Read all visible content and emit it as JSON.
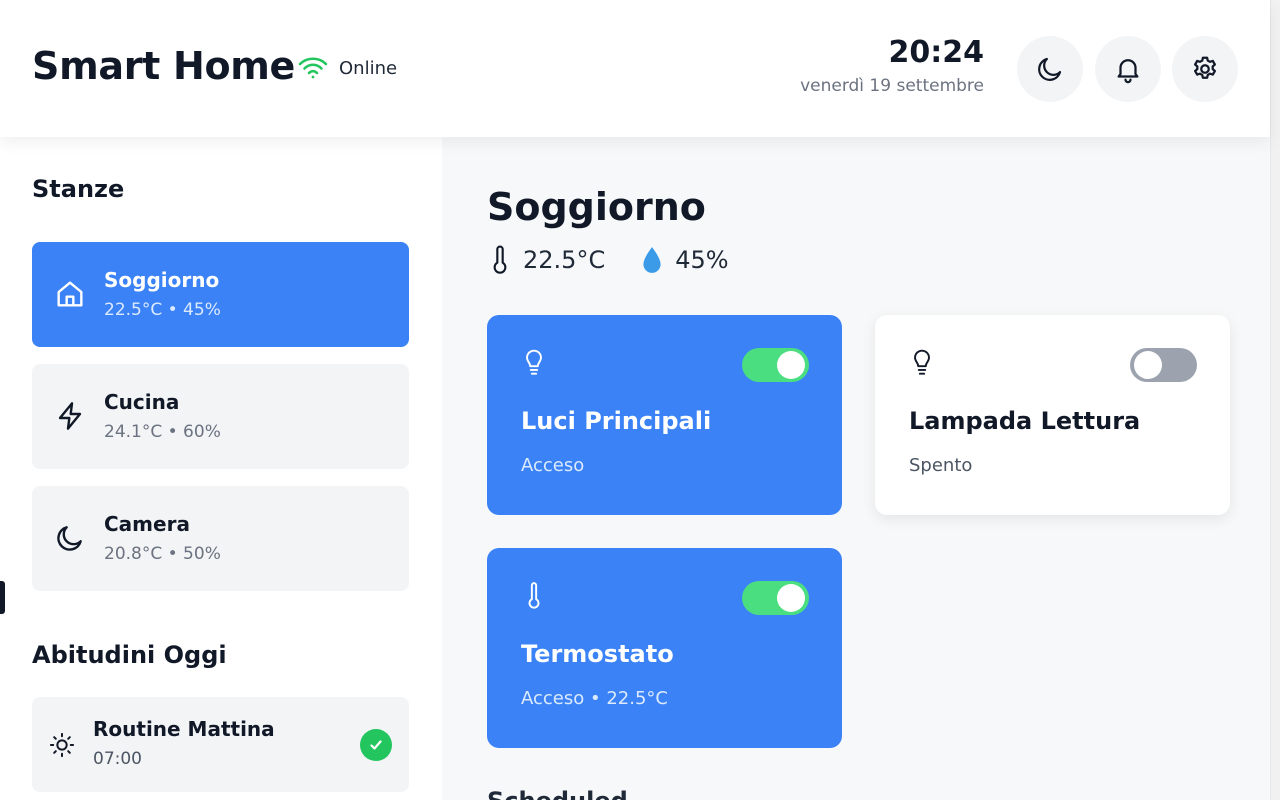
{
  "header": {
    "title": "Smart Home",
    "status": {
      "label": "Online",
      "icon": "wifi-icon",
      "color": "#22c55e"
    },
    "clock": {
      "time": "20:24",
      "date": "venerdì 19 settembre"
    },
    "buttons": [
      {
        "icon": "moon-icon"
      },
      {
        "icon": "bell-icon"
      },
      {
        "icon": "gear-icon"
      }
    ]
  },
  "sidebar": {
    "rooms_title": "Stanze",
    "rooms": [
      {
        "name": "Soggiorno",
        "meta": "22.5°C • 45%",
        "icon": "home-icon",
        "active": true
      },
      {
        "name": "Cucina",
        "meta": "24.1°C • 60%",
        "icon": "bolt-icon",
        "active": false
      },
      {
        "name": "Camera",
        "meta": "20.8°C • 50%",
        "icon": "moon-icon",
        "active": false
      }
    ],
    "habits_title": "Abitudini Oggi",
    "habits": [
      {
        "name": "Routine Mattina",
        "time": "07:00",
        "icon": "sun-icon",
        "done": true
      }
    ]
  },
  "main": {
    "room_title": "Soggiorno",
    "temperature": "22.5°C",
    "humidity": "45%",
    "devices": [
      {
        "name": "Luci Principali",
        "status": "Acceso",
        "icon": "lightbulb-icon",
        "on": true
      },
      {
        "name": "Lampada Lettura",
        "status": "Spento",
        "icon": "lightbulb-icon",
        "on": false
      },
      {
        "name": "Termostato",
        "status": "Acceso • 22.5°C",
        "icon": "thermometer-icon",
        "on": true
      }
    ],
    "next_section_title": "Scheduled"
  },
  "colors": {
    "accent": "#3b82f6",
    "toggle_on": "#4ade80",
    "toggle_off": "#9ca3af",
    "success": "#22c55e"
  }
}
